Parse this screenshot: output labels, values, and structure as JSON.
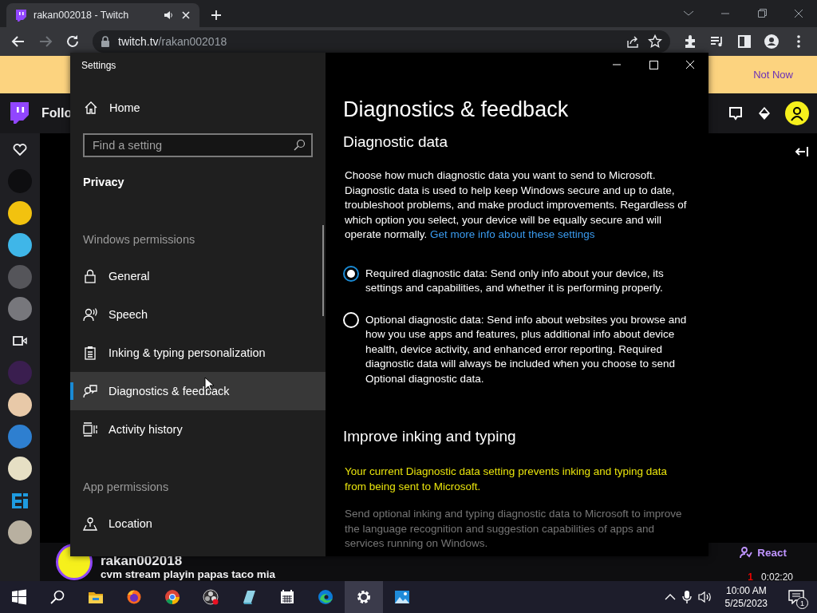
{
  "browser": {
    "tab": {
      "title": "rakan002018 - Twitch",
      "audio": true
    },
    "address": {
      "host": "twitch.tv",
      "path": "/rakan002018"
    },
    "back_disabled": false,
    "forward_disabled": true
  },
  "twitch": {
    "banner": {
      "button": "Not Now"
    },
    "nav": {
      "following": "Follo"
    },
    "sidebar": [
      {
        "kind": "heart"
      },
      {
        "kind": "avatar",
        "color": "#0e0e10"
      },
      {
        "kind": "avatar",
        "color": "#f2c20f"
      },
      {
        "kind": "avatar",
        "color": "#3fb6e8"
      },
      {
        "kind": "avatar",
        "color": "#55555a"
      },
      {
        "kind": "avatar",
        "color": "#77777c"
      },
      {
        "kind": "camera"
      },
      {
        "kind": "avatar",
        "color": "#3a1e4f"
      },
      {
        "kind": "avatar",
        "color": "#e8c9a8"
      },
      {
        "kind": "avatar",
        "color": "#2e7fd0"
      },
      {
        "kind": "avatar",
        "color": "#e6dfc4"
      },
      {
        "kind": "logo",
        "color": "#1e9be0"
      },
      {
        "kind": "avatar",
        "color": "#b8b0a0"
      }
    ],
    "channel": {
      "name": "rakan002018",
      "title": "cvm stream playin papas taco mia",
      "react": "React",
      "viewers": "1",
      "uptime": "0:02:20"
    }
  },
  "settings": {
    "title": "Settings",
    "home": "Home",
    "search": {
      "placeholder": "Find a setting"
    },
    "section": "Privacy",
    "groups": [
      {
        "heading": "Windows permissions",
        "items": [
          {
            "label": "General",
            "kind": "lock",
            "selected": false
          },
          {
            "label": "Speech",
            "kind": "speech",
            "selected": false
          },
          {
            "label": "Inking & typing personalization",
            "kind": "clipboard",
            "selected": false
          },
          {
            "label": "Diagnostics & feedback",
            "kind": "feedback",
            "selected": true
          },
          {
            "label": "Activity history",
            "kind": "activity",
            "selected": false
          }
        ]
      },
      {
        "heading": "App permissions",
        "items": [
          {
            "label": "Location",
            "kind": "location",
            "selected": false
          }
        ]
      }
    ],
    "page": {
      "heading": "Diagnostics & feedback",
      "sections": [
        {
          "title": "Diagnostic data",
          "text": "Choose how much diagnostic data you want to send to Microsoft. Diagnostic data is used to help keep Windows secure and up to date, troubleshoot problems, and make product improvements. Regardless of which option you select, your device will be equally secure and will operate normally.",
          "link": "Get more info about these settings",
          "options": [
            {
              "label": "Required diagnostic data: Send only info about your device, its settings and capabilities, and whether it is performing properly.",
              "selected": true
            },
            {
              "label": "Optional diagnostic data: Send info about websites you browse and how you use apps and features, plus additional info about device health, device activity, and enhanced error reporting. Required diagnostic data will always be included when you choose to send Optional diagnostic data.",
              "selected": false
            }
          ]
        },
        {
          "title": "Improve inking and typing",
          "warning": "Your current Diagnostic data setting prevents inking and typing data from being sent to Microsoft.",
          "text": "Send optional inking and typing diagnostic data to Microsoft to improve the language recognition and suggestion capabilities of apps and services running on Windows.",
          "disabled": true
        }
      ]
    }
  },
  "taskbar": {
    "apps": [
      {
        "kind": "search",
        "selected": false
      },
      {
        "kind": "folder",
        "selected": false
      },
      {
        "kind": "firefox",
        "selected": false
      },
      {
        "kind": "chrome",
        "selected": false
      },
      {
        "kind": "obs",
        "selected": false
      },
      {
        "kind": "notes",
        "selected": false
      },
      {
        "kind": "calendar",
        "selected": false
      },
      {
        "kind": "edge",
        "selected": false
      },
      {
        "kind": "settings",
        "selected": true
      },
      {
        "kind": "photos",
        "selected": false
      }
    ],
    "time": "10:00 AM",
    "date": "5/25/2023",
    "notifications": "1"
  }
}
